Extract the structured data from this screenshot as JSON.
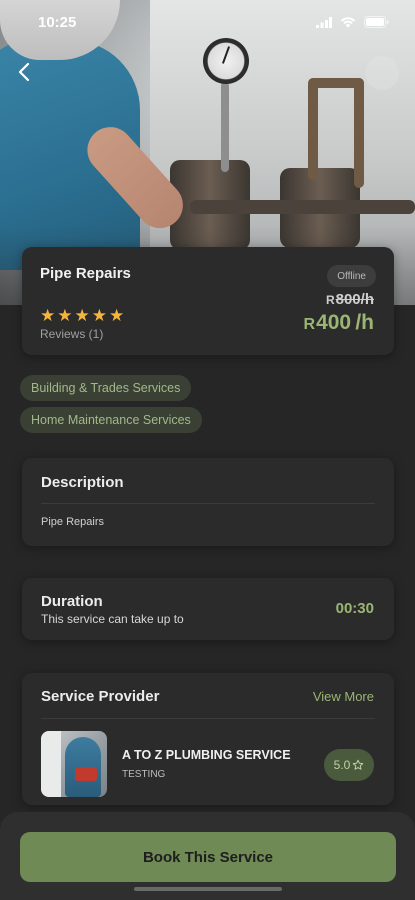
{
  "status_bar": {
    "time": "10:25"
  },
  "service": {
    "title": "Pipe Repairs",
    "status": "Offline",
    "rating_stars": 5,
    "reviews": "Reviews (1)",
    "old_price": {
      "currency": "R",
      "amount": "800",
      "unit": "/h"
    },
    "new_price": {
      "currency": "R",
      "amount": "400",
      "unit": "/h"
    },
    "categories": [
      "Building & Trades Services",
      "Home Maintenance Services"
    ]
  },
  "description": {
    "heading": "Description",
    "text": "Pipe Repairs"
  },
  "duration": {
    "heading": "Duration",
    "subtitle": "This service can take up to",
    "value": "00:30"
  },
  "provider": {
    "heading": "Service Provider",
    "view_more": "View More",
    "name": "A TO Z PLUMBING SERVICE",
    "subtitle": "TESTING",
    "rating": "5.0"
  },
  "cta": {
    "book_label": "Book This Service"
  },
  "colors": {
    "accent": "#9bb574",
    "button": "#6f8a55",
    "star": "#f5b53a",
    "background": "#262626"
  },
  "icons": {
    "back": "chevron-left-icon",
    "star": "star-icon",
    "wifi": "wifi-icon",
    "battery": "battery-icon",
    "signal": "signal-icon"
  }
}
